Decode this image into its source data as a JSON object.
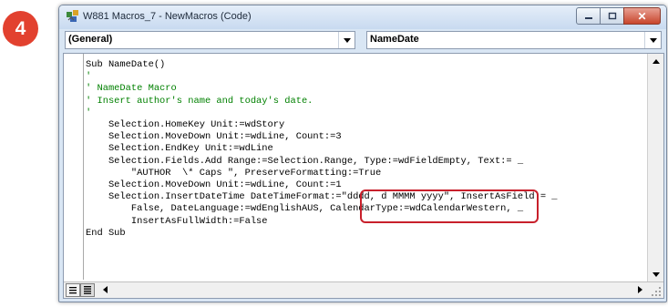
{
  "step": {
    "number": "4"
  },
  "window": {
    "title": "W881 Macros_7 - NewMacros (Code)",
    "controls": {
      "close": "✕"
    }
  },
  "toolbar": {
    "object_combo": "(General)",
    "procedure_combo": "NameDate"
  },
  "code": {
    "lines": [
      {
        "text": "Sub NameDate()",
        "kind": "code"
      },
      {
        "text": "'",
        "kind": "comment"
      },
      {
        "text": "' NameDate Macro",
        "kind": "comment"
      },
      {
        "text": "' Insert author's name and today's date.",
        "kind": "comment"
      },
      {
        "text": "'",
        "kind": "comment"
      },
      {
        "text": "    Selection.HomeKey Unit:=wdStory",
        "kind": "code"
      },
      {
        "text": "    Selection.MoveDown Unit:=wdLine, Count:=3",
        "kind": "code"
      },
      {
        "text": "    Selection.EndKey Unit:=wdLine",
        "kind": "code"
      },
      {
        "text": "    Selection.Fields.Add Range:=Selection.Range, Type:=wdFieldEmpty, Text:= _",
        "kind": "code"
      },
      {
        "text": "        \"AUTHOR  \\* Caps \", PreserveFormatting:=True",
        "kind": "code"
      },
      {
        "text": "    Selection.MoveDown Unit:=wdLine, Count:=1",
        "kind": "code"
      },
      {
        "text": "    Selection.InsertDateTime DateTimeFormat:=\"dddd, d MMMM yyyy\", InsertAsField:= _",
        "kind": "code"
      },
      {
        "text": "        False, DateLanguage:=wdEnglishAUS, CalendarType:=wdCalendarWestern, _",
        "kind": "code"
      },
      {
        "text": "        InsertAsFullWidth:=False",
        "kind": "code"
      },
      {
        "text": "End Sub",
        "kind": "code"
      }
    ]
  },
  "colors": {
    "comment": "#008000",
    "highlight": "#c8202b",
    "step_badge": "#e2412f"
  }
}
